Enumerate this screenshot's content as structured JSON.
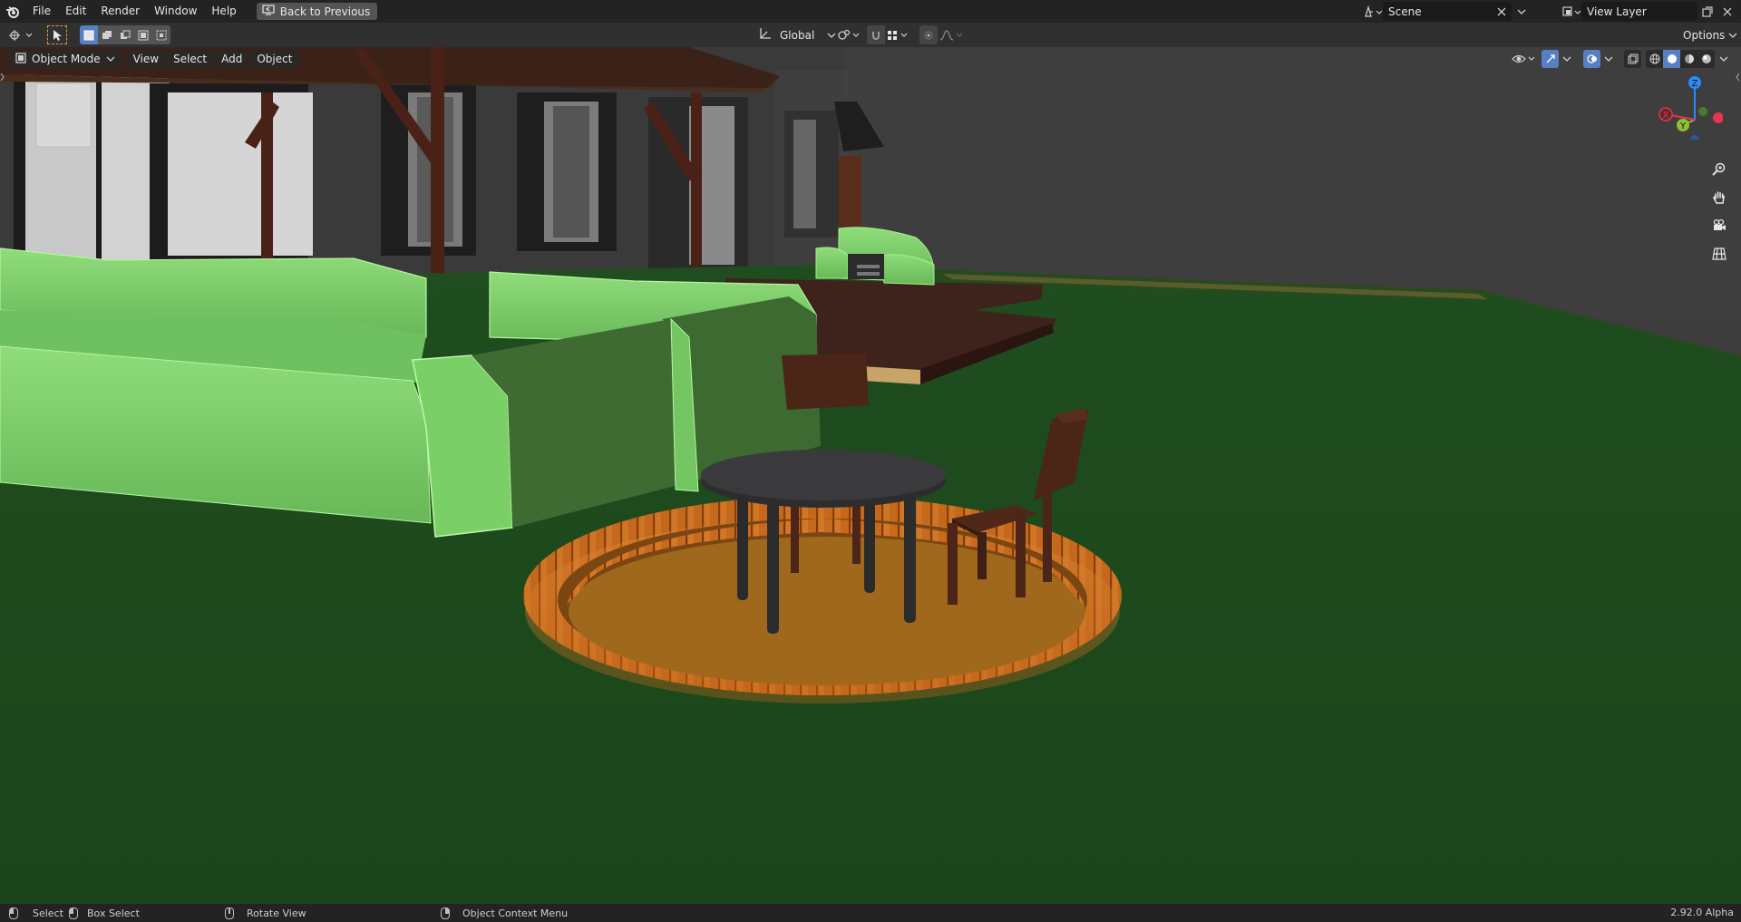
{
  "menubar": {
    "menus": [
      "File",
      "Edit",
      "Render",
      "Window",
      "Help"
    ],
    "back_button": "Back to Previous",
    "scene_name": "Scene",
    "view_layer_name": "View Layer"
  },
  "toolheader": {
    "transform_orientation": "Global",
    "options_label": "Options"
  },
  "viewport": {
    "mode": "Object Mode",
    "menus": [
      "View",
      "Select",
      "Add",
      "Object"
    ],
    "gizmo_axes": {
      "z": "Z",
      "y": "Y",
      "x": "X"
    }
  },
  "statusbar": {
    "select": "Select",
    "box_select": "Box Select",
    "rotate_view": "Rotate View",
    "context_menu": "Object Context Menu",
    "version": "2.92.0 Alpha"
  },
  "colors": {
    "accent": "#5680c2",
    "header_bg": "#303030",
    "topbar_bg": "#232323",
    "grass": "#1f4a1f",
    "hedge": "#7fcf6a",
    "deck": "#3e221c",
    "fire_pit_rim": "#d4741f",
    "fire_pit_floor": "#a0681c",
    "table_top": "#2d2d2f",
    "chair": "#4a2518",
    "axis_x": "#e8344c",
    "axis_y": "#8bc23a",
    "axis_z": "#2a8bff"
  }
}
